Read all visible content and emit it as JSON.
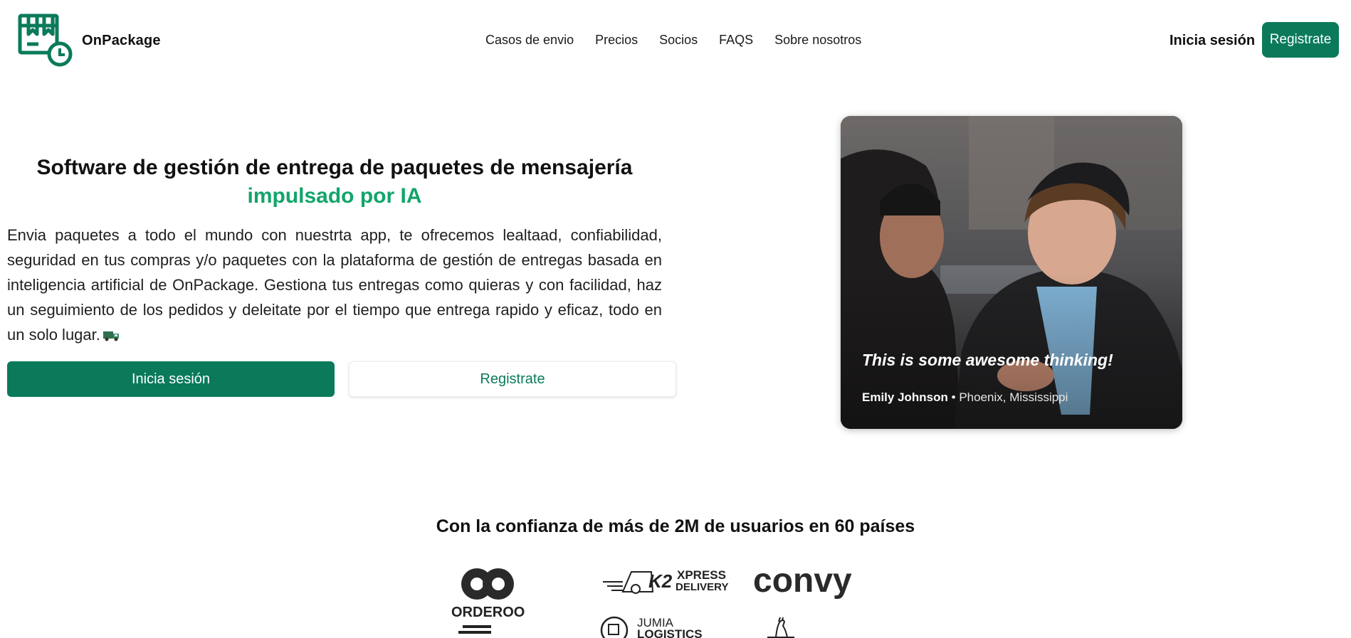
{
  "brand": {
    "name": "OnPackage",
    "accent": "#0a7a5a",
    "highlight": "#12a56a"
  },
  "nav": {
    "items": [
      {
        "label": "Casos de envio"
      },
      {
        "label": "Precios"
      },
      {
        "label": "Socios"
      },
      {
        "label": "FAQS"
      },
      {
        "label": "Sobre nosotros"
      }
    ],
    "signin_label": "Inicia sesión",
    "register_label": "Registrate"
  },
  "hero": {
    "title": "Software de gestión de entrega de paquetes de mensajería",
    "title_accent": "impulsado por IA",
    "description": "Envia paquetes a todo el mundo con nuestrta app, te ofrecemos lealtaad, confiabilidad, seguridad en tus compras y/o paquetes con la plataforma de gestión de entregas basada en inteligencia artificial de OnPackage. Gestiona tus entregas como quieras y con facilidad, haz un seguimiento de los pedidos y deleitate por el tiempo que entrega rapido y eficaz, todo en un solo lugar.",
    "primary_button": "Inicia sesión",
    "secondary_button": "Registrate"
  },
  "testimonial": {
    "quote": "This is some awesome thinking!",
    "author": "Emily Johnson",
    "separator": "•",
    "location": "Phoenix, Mississippi"
  },
  "trust": {
    "title": "Con la confianza de más de 2M de usuarios en 60 países",
    "logos": [
      {
        "name": "ORDEROO"
      },
      {
        "name": "XPRESS",
        "sub": "DELIVERY",
        "mark": "K2"
      },
      {
        "name": "convy"
      },
      {
        "name": "JUMIA",
        "sub": "LOGISTICS"
      }
    ]
  }
}
